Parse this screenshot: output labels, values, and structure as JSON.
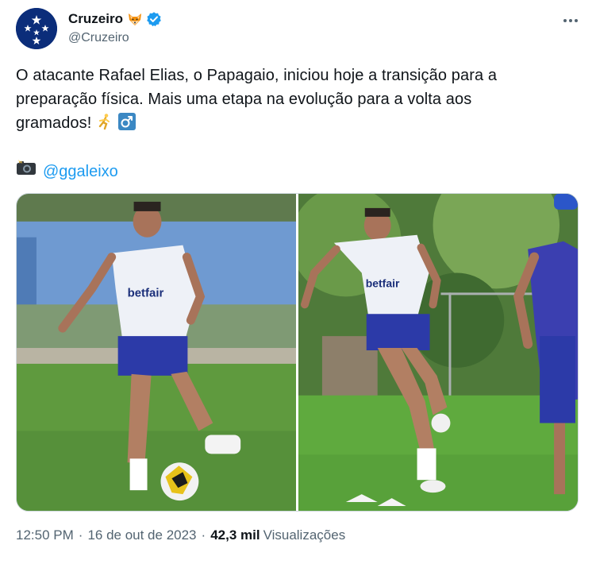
{
  "account": {
    "display_name": "Cruzeiro",
    "handle": "@Cruzeiro",
    "avatar_icon": "cruzeiro-stars-logo",
    "badge_emoji_icon": "fox-face-icon",
    "verified_icon": "verified-badge-icon",
    "verified_color": "#1d9bf0"
  },
  "menu": {
    "more_icon": "more-horizontal-icon"
  },
  "tweet": {
    "text_line1": "O atacante Rafael Elias, o Papagaio, iniciou hoje a transição para a",
    "text_line2": "preparação física. Mais uma etapa na evolução para a volta aos",
    "text_line3": "gramados!",
    "emoji_icons": [
      "person-running-icon",
      "male-sign-icon"
    ],
    "photo_credit_icon": "camera-flash-icon",
    "photo_credit_mention": "@ggaleixo"
  },
  "media": {
    "photos": [
      {
        "name": "photo-player-with-ball",
        "shirt_sponsor": "betfair"
      },
      {
        "name": "photo-player-running",
        "shirt_sponsor": "betfair"
      }
    ]
  },
  "meta": {
    "time": "12:50 PM",
    "separator": "·",
    "date": "16 de out de 2023",
    "views_count": "42,3 mil",
    "views_label": "Visualizações"
  },
  "colors": {
    "link": "#1d9bf0",
    "text": "#0f1419",
    "secondary": "#536471",
    "brand_blue": "#0b2d7a"
  }
}
